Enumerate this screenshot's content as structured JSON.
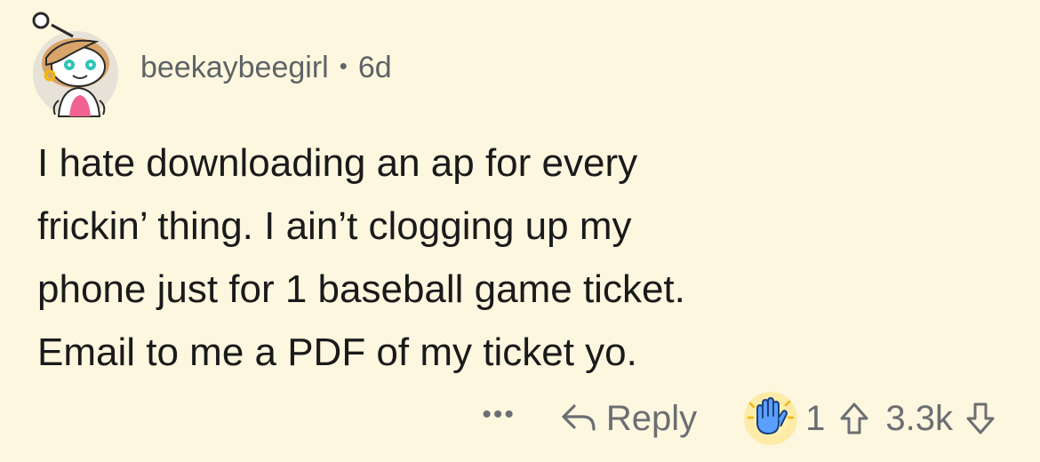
{
  "comment": {
    "username": "beekaybeegirl",
    "separator": "•",
    "age": "6d",
    "text": "I hate downloading an ap for every\nfrickin’ thing. I ain’t clogging up my\nphone just for 1 baseball game ticket.\nEmail to me a PDF of my ticket yo."
  },
  "actions": {
    "more_label": "•••",
    "reply_label": "Reply",
    "award_count": "1",
    "score": "3.3k"
  },
  "icons": {
    "avatar": "snoo-avatar-icon",
    "reply": "reply-arrow-icon",
    "award": "clapping-hands-award-icon",
    "upvote": "upvote-arrow-icon",
    "downvote": "downvote-arrow-icon"
  },
  "colors": {
    "background": "#fdf7df",
    "text": "#1a1a1b",
    "muted": "#6b6e72",
    "award_glow": "#ffe27a",
    "award_hand": "#5aa0ff"
  }
}
